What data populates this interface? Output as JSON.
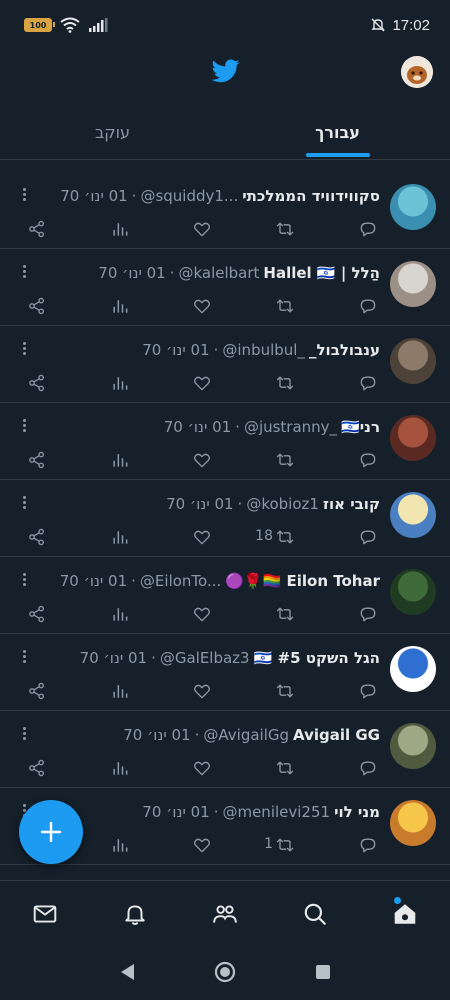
{
  "status_bar": {
    "battery": "100",
    "time": "17:02",
    "icons": [
      "battery-icon",
      "wifi-icon",
      "signal-icon",
      "bell-off-icon"
    ]
  },
  "header": {
    "logo": "twitter-bird-icon",
    "avatar": "profile-avatar"
  },
  "tabs": [
    {
      "label": "עבורך",
      "active": true
    },
    {
      "label": "עוקב",
      "active": false
    }
  ],
  "feed": [
    {
      "name": "סקווידוויד הממלכתי",
      "handle": "@squiddy1...",
      "time": "01 ינו׳ 70",
      "retweets": "",
      "avatar_colors": [
        "#6cc3d6",
        "#3a8fb0"
      ]
    },
    {
      "name": "הַלל | Hallel 🇮🇱",
      "handle": "@kalelbart",
      "time": "01 ינו׳ 70",
      "retweets": "",
      "avatar_colors": [
        "#d8d4cf",
        "#9c8f86"
      ]
    },
    {
      "name": "ענבולבול_",
      "handle": "@inbulbul_",
      "time": "01 ינו׳ 70",
      "retweets": "",
      "avatar_colors": [
        "#8d7b6a",
        "#4d4238"
      ]
    },
    {
      "name": "רני🇮🇱",
      "handle": "@justranny_",
      "time": "01 ינו׳ 70",
      "retweets": "",
      "avatar_colors": [
        "#a5533f",
        "#5a2a22"
      ]
    },
    {
      "name": "קובי אוז",
      "handle": "@kobioz1",
      "time": "01 ינו׳ 70",
      "retweets": "18",
      "avatar_colors": [
        "#f2e6b0",
        "#4a7fc1"
      ]
    },
    {
      "name": "Eilon Tohar 🏳️‍🌈🌹🟣",
      "handle": "@EilonTo...",
      "time": "01 ינו׳ 70",
      "retweets": "",
      "avatar_colors": [
        "#3f6b3a",
        "#1f3b22"
      ]
    },
    {
      "name": "הגל השקט #5 🇮🇱",
      "handle": "@GalElbaz3",
      "time": "01 ינו׳ 70",
      "retweets": "",
      "avatar_colors": [
        "#2f6fd1",
        "#ffffff"
      ]
    },
    {
      "name": "Avigail GG",
      "handle": "@AvigailGg",
      "time": "01 ינו׳ 70",
      "retweets": "",
      "avatar_colors": [
        "#9ea885",
        "#4f5a3f"
      ]
    },
    {
      "name": "מני לוי",
      "handle": "@menilevi251",
      "time": "01 ינו׳ 70",
      "retweets": "1",
      "avatar_colors": [
        "#f5c64a",
        "#c77b2b"
      ]
    }
  ],
  "fab": {
    "icon": "plus-icon"
  },
  "bottom_nav": [
    "mail-icon",
    "notifications-icon",
    "communities-icon",
    "search-icon",
    "home-icon"
  ],
  "system_nav": [
    "back-icon",
    "home-circle-icon",
    "recents-icon"
  ],
  "colors": {
    "background": "#15202b",
    "accent": "#1d9bf0",
    "muted": "#8b98a5",
    "divider": "#2f3b47"
  }
}
